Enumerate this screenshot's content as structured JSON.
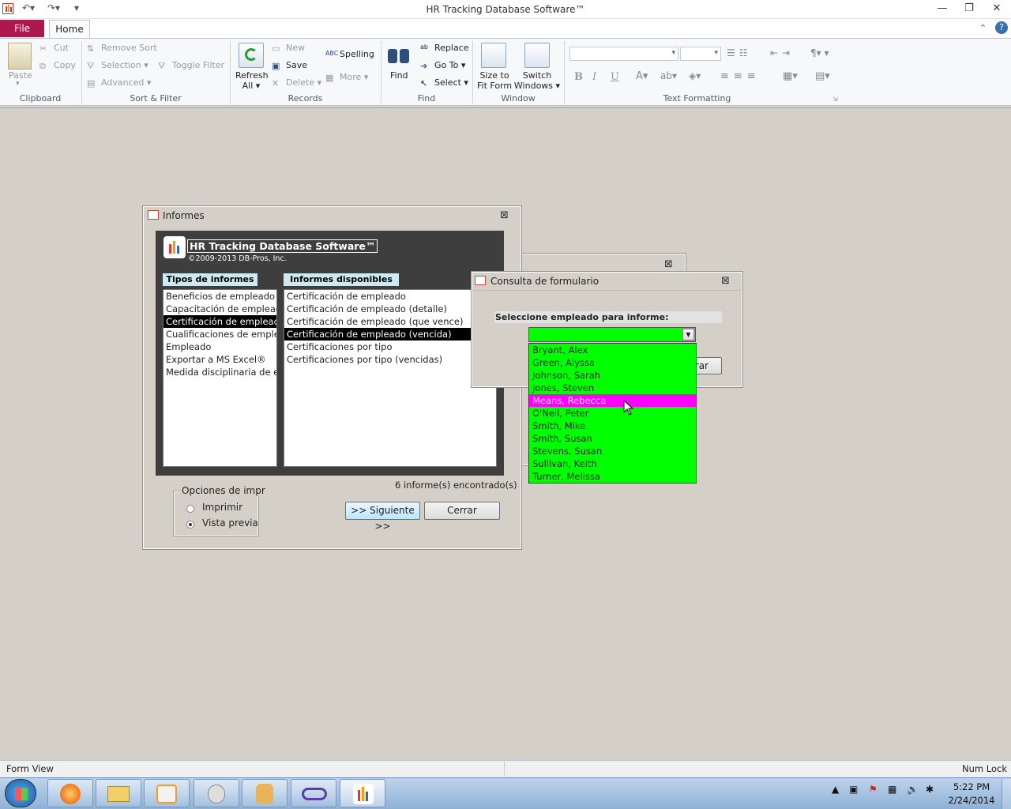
{
  "app": {
    "title": "HR Tracking Database Software™",
    "window_controls": {
      "minimize": "—",
      "restore": "❐",
      "close": "✕"
    }
  },
  "tabs": {
    "file": "File",
    "home": "Home"
  },
  "ribbon": {
    "clipboard": {
      "paste": "Paste",
      "cut": "Cut",
      "copy": "Copy",
      "label": "Clipboard"
    },
    "sort_filter": {
      "remove_sort": "Remove Sort",
      "selection": "Selection",
      "advanced": "Advanced",
      "toggle_filter": "Toggle Filter",
      "label": "Sort & Filter"
    },
    "records": {
      "refresh": "Refresh",
      "refresh_all": "All",
      "new": "New",
      "save": "Save",
      "delete": "Delete",
      "spelling": "Spelling",
      "more": "More",
      "label": "Records"
    },
    "find": {
      "find": "Find",
      "replace": "Replace",
      "goto": "Go To",
      "select": "Select",
      "label": "Find"
    },
    "window": {
      "size_fit_1": "Size to",
      "size_fit_2": "Fit Form",
      "switch_1": "Switch",
      "switch_2": "Windows",
      "label": "Window"
    },
    "text_formatting": {
      "bold": "B",
      "italic": "I",
      "underline": "U",
      "label": "Text Formatting"
    }
  },
  "informes": {
    "title": "Informes",
    "brand_title": "HR Tracking Database Software™",
    "brand_copyright": "©2009-2013 DB-Pros, Inc.",
    "types_header": "Tipos de informes",
    "available_header": "Informes disponibles",
    "types": [
      "Beneficios de empleado",
      "Capacitación de empleado",
      "Certificación de empleado",
      "Cualificaciones de empleado",
      "Empleado",
      "Exportar a MS Excel®",
      "Medida disciplinaria de empleado"
    ],
    "types_selected": 2,
    "available": [
      "Certificación de empleado",
      "Certificación de empleado (detalle)",
      "Certificación de empleado (que vence)",
      "Certificación de empleado (vencida)",
      "Certificaciones por tipo",
      "Certificaciones por tipo (vencidas)"
    ],
    "available_selected": 3,
    "found_count": "6 informe(s) encontrado(s)",
    "print_options_label": "Opciones de impr",
    "print_option": "Imprimir",
    "preview_option": "Vista previa",
    "next_button": ">> Siguiente >>",
    "close_button": "Cerrar"
  },
  "consulta": {
    "title": "Consulta de formulario",
    "prompt": "Seleccione empleado para informe:",
    "combo_value": "",
    "behind_button_fragment": "rar",
    "employees": [
      "Bryant, Alex",
      "Green, Alyssa",
      "Johnson, Sarah",
      "Jones, Steven",
      "Means, Rebecca",
      "O'Neil, Peter",
      "Smith, Mike",
      "Smith, Susan",
      "Stevens, Susan",
      "Sullivan, Keith",
      "Turner, Melissa"
    ],
    "highlighted": 4
  },
  "statusbar": {
    "left": "Form View",
    "right": "Num Lock"
  },
  "taskbar": {
    "time": "5:22 PM",
    "date": "2/24/2014"
  },
  "colors": {
    "file_tab": "#b0174e",
    "list_bg": "#00ff00",
    "highlight": "#ff00ff",
    "header_label": "#cde9f1"
  }
}
